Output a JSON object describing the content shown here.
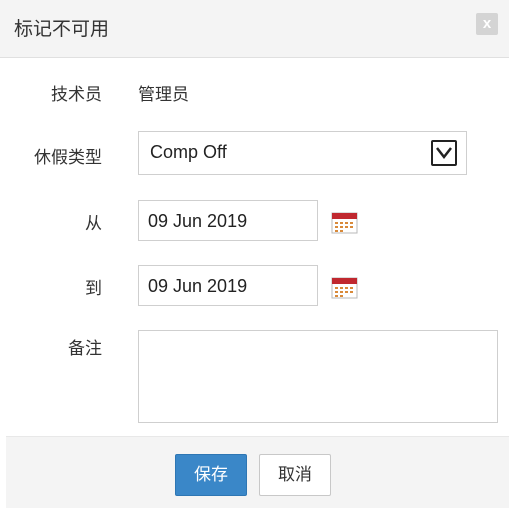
{
  "dialog": {
    "title": "标记不可用",
    "close_label": "x"
  },
  "form": {
    "technician": {
      "label": "技术员",
      "value": "管理员"
    },
    "leave_type": {
      "label": "休假类型",
      "selected": "Comp Off"
    },
    "from": {
      "label": "从",
      "value": "09 Jun 2019"
    },
    "to": {
      "label": "到",
      "value": "09 Jun 2019"
    },
    "notes": {
      "label": "备注",
      "value": ""
    }
  },
  "footer": {
    "save_label": "保存",
    "cancel_label": "取消"
  },
  "colors": {
    "primary": "#3a87c8",
    "header_bg": "#f4f4f4",
    "calendar_red": "#c0282f"
  }
}
